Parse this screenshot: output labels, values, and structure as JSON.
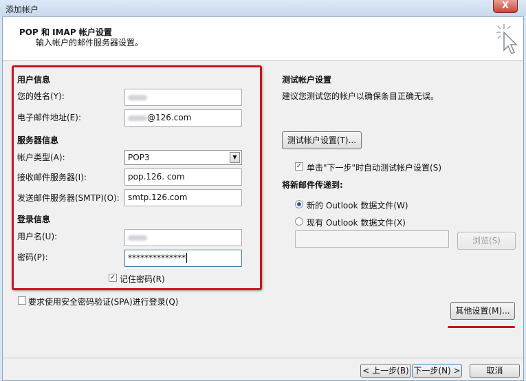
{
  "window": {
    "title": "添加帐户",
    "close": "X"
  },
  "header": {
    "title": "POP 和 IMAP 帐户设置",
    "subtitle": "输入帐户的邮件服务器设置。",
    "icon": "cursor-sparkle-icon"
  },
  "user_info": {
    "section": "用户信息",
    "name_label": "您的姓名(Y):",
    "email_label": "电子邮件地址(E):",
    "email_suffix": "@126.com"
  },
  "server_info": {
    "section": "服务器信息",
    "account_type_label": "帐户类型(A):",
    "account_type_value": "POP3",
    "incoming_label": "接收邮件服务器(I):",
    "incoming_value": "pop.126. com",
    "outgoing_label": "发送邮件服务器(SMTP)(O):",
    "outgoing_value": "smtp.126.com"
  },
  "login_info": {
    "section": "登录信息",
    "username_label": "用户名(U):",
    "password_label": "密码(P):",
    "password_value": "**************",
    "remember_label": "记住密码(R)",
    "remember_checked": true
  },
  "spa": {
    "label": "要求使用安全密码验证(SPA)进行登录(Q)",
    "checked": false
  },
  "test": {
    "section": "测试帐户设置",
    "description": "建议您测试您的帐户以确保条目正确无误。",
    "button": "测试帐户设置(T)...",
    "auto_test_label": "单击\"下一步\"时自动测试帐户设置(S)",
    "auto_test_checked": true
  },
  "delivery": {
    "section": "将新邮件传递到:",
    "new_file_label": "新的 Outlook 数据文件(W)",
    "existing_file_label": "现有 Outlook 数据文件(X)",
    "selected": "new",
    "browse_button": "浏览(S)"
  },
  "more_settings_button": "其他设置(M)...",
  "footer": {
    "back": "< 上一步(B)",
    "next": "下一步(N) >",
    "cancel": "取消"
  },
  "colors": {
    "highlight": "#c9141c",
    "titlebar": "#d7e4f2"
  }
}
